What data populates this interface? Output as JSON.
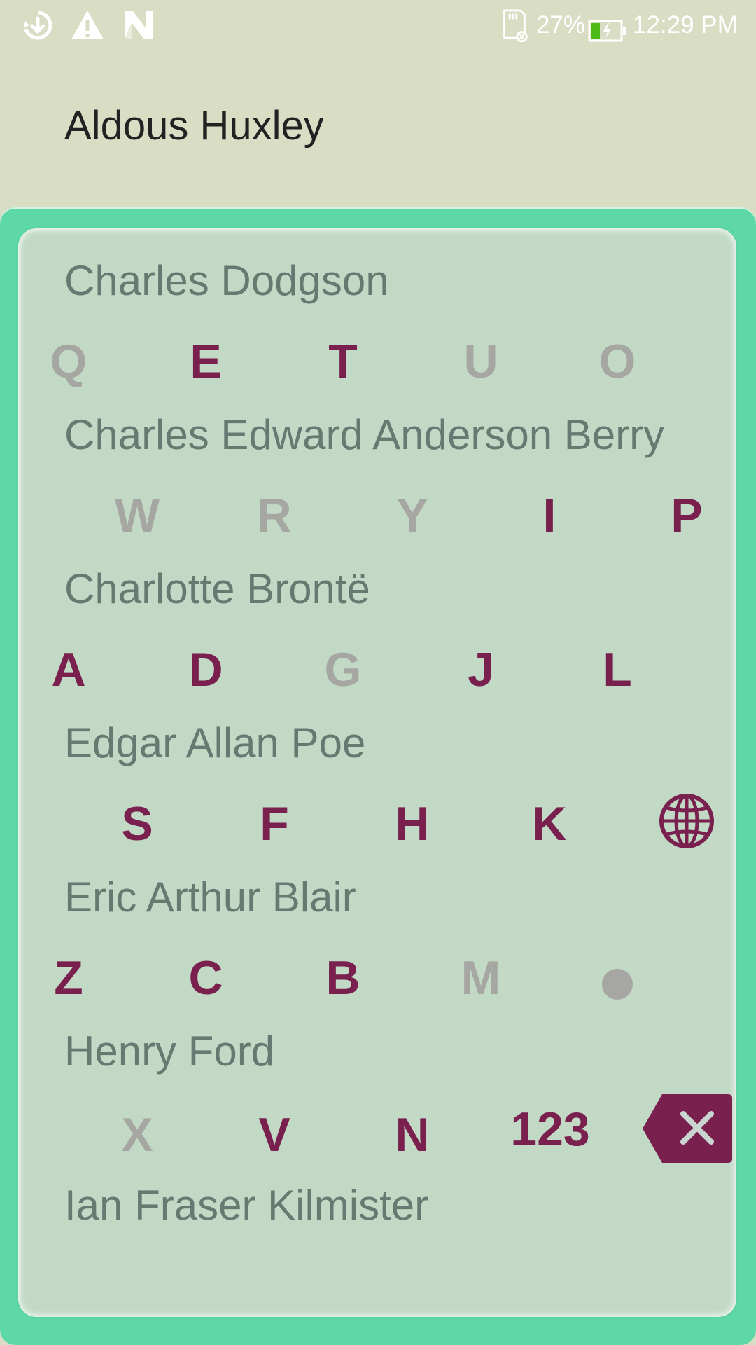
{
  "status_bar": {
    "battery_percent": "27%",
    "time": "12:29 PM",
    "icons": [
      "download-icon",
      "warning-icon",
      "n-logo-icon",
      "sd-card-icon",
      "battery-charging-icon"
    ]
  },
  "header": {
    "title": "Aldous Huxley"
  },
  "list": {
    "items": [
      "Charles Dodgson",
      "Charles Edward Anderson Berry",
      "Charlotte Brontë",
      "Edgar Allan Poe",
      "Eric Arthur Blair",
      "Henry Ford",
      "Ian Fraser Kilmister"
    ]
  },
  "keyboard": {
    "row1": [
      "Q",
      "E",
      "T",
      "U",
      "O"
    ],
    "row2": [
      "W",
      "R",
      "Y",
      "I",
      "P"
    ],
    "row3": [
      "A",
      "D",
      "G",
      "J",
      "L"
    ],
    "row4": [
      "S",
      "F",
      "H",
      "K"
    ],
    "row5": [
      "Z",
      "C",
      "B",
      "M"
    ],
    "row6": [
      "X",
      "V",
      "N",
      "123"
    ],
    "globe_icon": "globe-icon",
    "dot_icon": "dot-icon",
    "backspace_icon": "backspace-icon",
    "active_color": "#79204f",
    "inactive_color": "#a6a6a2"
  },
  "colors": {
    "background": "#d8ddc4",
    "panel_border": "#5fd8a8",
    "panel_fill": "#c1d9c5",
    "list_text": "#677a72"
  }
}
